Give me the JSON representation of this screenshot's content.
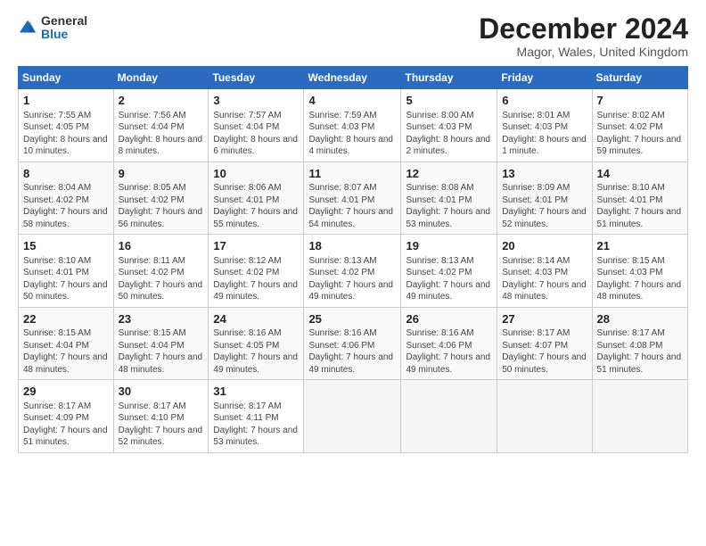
{
  "header": {
    "logo_general": "General",
    "logo_blue": "Blue",
    "title": "December 2024",
    "location": "Magor, Wales, United Kingdom"
  },
  "weekdays": [
    "Sunday",
    "Monday",
    "Tuesday",
    "Wednesday",
    "Thursday",
    "Friday",
    "Saturday"
  ],
  "weeks": [
    [
      {
        "day": 1,
        "sunrise": "7:55 AM",
        "sunset": "4:05 PM",
        "daylight": "8 hours and 10 minutes."
      },
      {
        "day": 2,
        "sunrise": "7:56 AM",
        "sunset": "4:04 PM",
        "daylight": "8 hours and 8 minutes."
      },
      {
        "day": 3,
        "sunrise": "7:57 AM",
        "sunset": "4:04 PM",
        "daylight": "8 hours and 6 minutes."
      },
      {
        "day": 4,
        "sunrise": "7:59 AM",
        "sunset": "4:03 PM",
        "daylight": "8 hours and 4 minutes."
      },
      {
        "day": 5,
        "sunrise": "8:00 AM",
        "sunset": "4:03 PM",
        "daylight": "8 hours and 2 minutes."
      },
      {
        "day": 6,
        "sunrise": "8:01 AM",
        "sunset": "4:03 PM",
        "daylight": "8 hours and 1 minute."
      },
      {
        "day": 7,
        "sunrise": "8:02 AM",
        "sunset": "4:02 PM",
        "daylight": "7 hours and 59 minutes."
      }
    ],
    [
      {
        "day": 8,
        "sunrise": "8:04 AM",
        "sunset": "4:02 PM",
        "daylight": "7 hours and 58 minutes."
      },
      {
        "day": 9,
        "sunrise": "8:05 AM",
        "sunset": "4:02 PM",
        "daylight": "7 hours and 56 minutes."
      },
      {
        "day": 10,
        "sunrise": "8:06 AM",
        "sunset": "4:01 PM",
        "daylight": "7 hours and 55 minutes."
      },
      {
        "day": 11,
        "sunrise": "8:07 AM",
        "sunset": "4:01 PM",
        "daylight": "7 hours and 54 minutes."
      },
      {
        "day": 12,
        "sunrise": "8:08 AM",
        "sunset": "4:01 PM",
        "daylight": "7 hours and 53 minutes."
      },
      {
        "day": 13,
        "sunrise": "8:09 AM",
        "sunset": "4:01 PM",
        "daylight": "7 hours and 52 minutes."
      },
      {
        "day": 14,
        "sunrise": "8:10 AM",
        "sunset": "4:01 PM",
        "daylight": "7 hours and 51 minutes."
      }
    ],
    [
      {
        "day": 15,
        "sunrise": "8:10 AM",
        "sunset": "4:01 PM",
        "daylight": "7 hours and 50 minutes."
      },
      {
        "day": 16,
        "sunrise": "8:11 AM",
        "sunset": "4:02 PM",
        "daylight": "7 hours and 50 minutes."
      },
      {
        "day": 17,
        "sunrise": "8:12 AM",
        "sunset": "4:02 PM",
        "daylight": "7 hours and 49 minutes."
      },
      {
        "day": 18,
        "sunrise": "8:13 AM",
        "sunset": "4:02 PM",
        "daylight": "7 hours and 49 minutes."
      },
      {
        "day": 19,
        "sunrise": "8:13 AM",
        "sunset": "4:02 PM",
        "daylight": "7 hours and 49 minutes."
      },
      {
        "day": 20,
        "sunrise": "8:14 AM",
        "sunset": "4:03 PM",
        "daylight": "7 hours and 48 minutes."
      },
      {
        "day": 21,
        "sunrise": "8:15 AM",
        "sunset": "4:03 PM",
        "daylight": "7 hours and 48 minutes."
      }
    ],
    [
      {
        "day": 22,
        "sunrise": "8:15 AM",
        "sunset": "4:04 PM",
        "daylight": "7 hours and 48 minutes."
      },
      {
        "day": 23,
        "sunrise": "8:15 AM",
        "sunset": "4:04 PM",
        "daylight": "7 hours and 48 minutes."
      },
      {
        "day": 24,
        "sunrise": "8:16 AM",
        "sunset": "4:05 PM",
        "daylight": "7 hours and 49 minutes."
      },
      {
        "day": 25,
        "sunrise": "8:16 AM",
        "sunset": "4:06 PM",
        "daylight": "7 hours and 49 minutes."
      },
      {
        "day": 26,
        "sunrise": "8:16 AM",
        "sunset": "4:06 PM",
        "daylight": "7 hours and 49 minutes."
      },
      {
        "day": 27,
        "sunrise": "8:17 AM",
        "sunset": "4:07 PM",
        "daylight": "7 hours and 50 minutes."
      },
      {
        "day": 28,
        "sunrise": "8:17 AM",
        "sunset": "4:08 PM",
        "daylight": "7 hours and 51 minutes."
      }
    ],
    [
      {
        "day": 29,
        "sunrise": "8:17 AM",
        "sunset": "4:09 PM",
        "daylight": "7 hours and 51 minutes."
      },
      {
        "day": 30,
        "sunrise": "8:17 AM",
        "sunset": "4:10 PM",
        "daylight": "7 hours and 52 minutes."
      },
      {
        "day": 31,
        "sunrise": "8:17 AM",
        "sunset": "4:11 PM",
        "daylight": "7 hours and 53 minutes."
      },
      null,
      null,
      null,
      null
    ]
  ]
}
